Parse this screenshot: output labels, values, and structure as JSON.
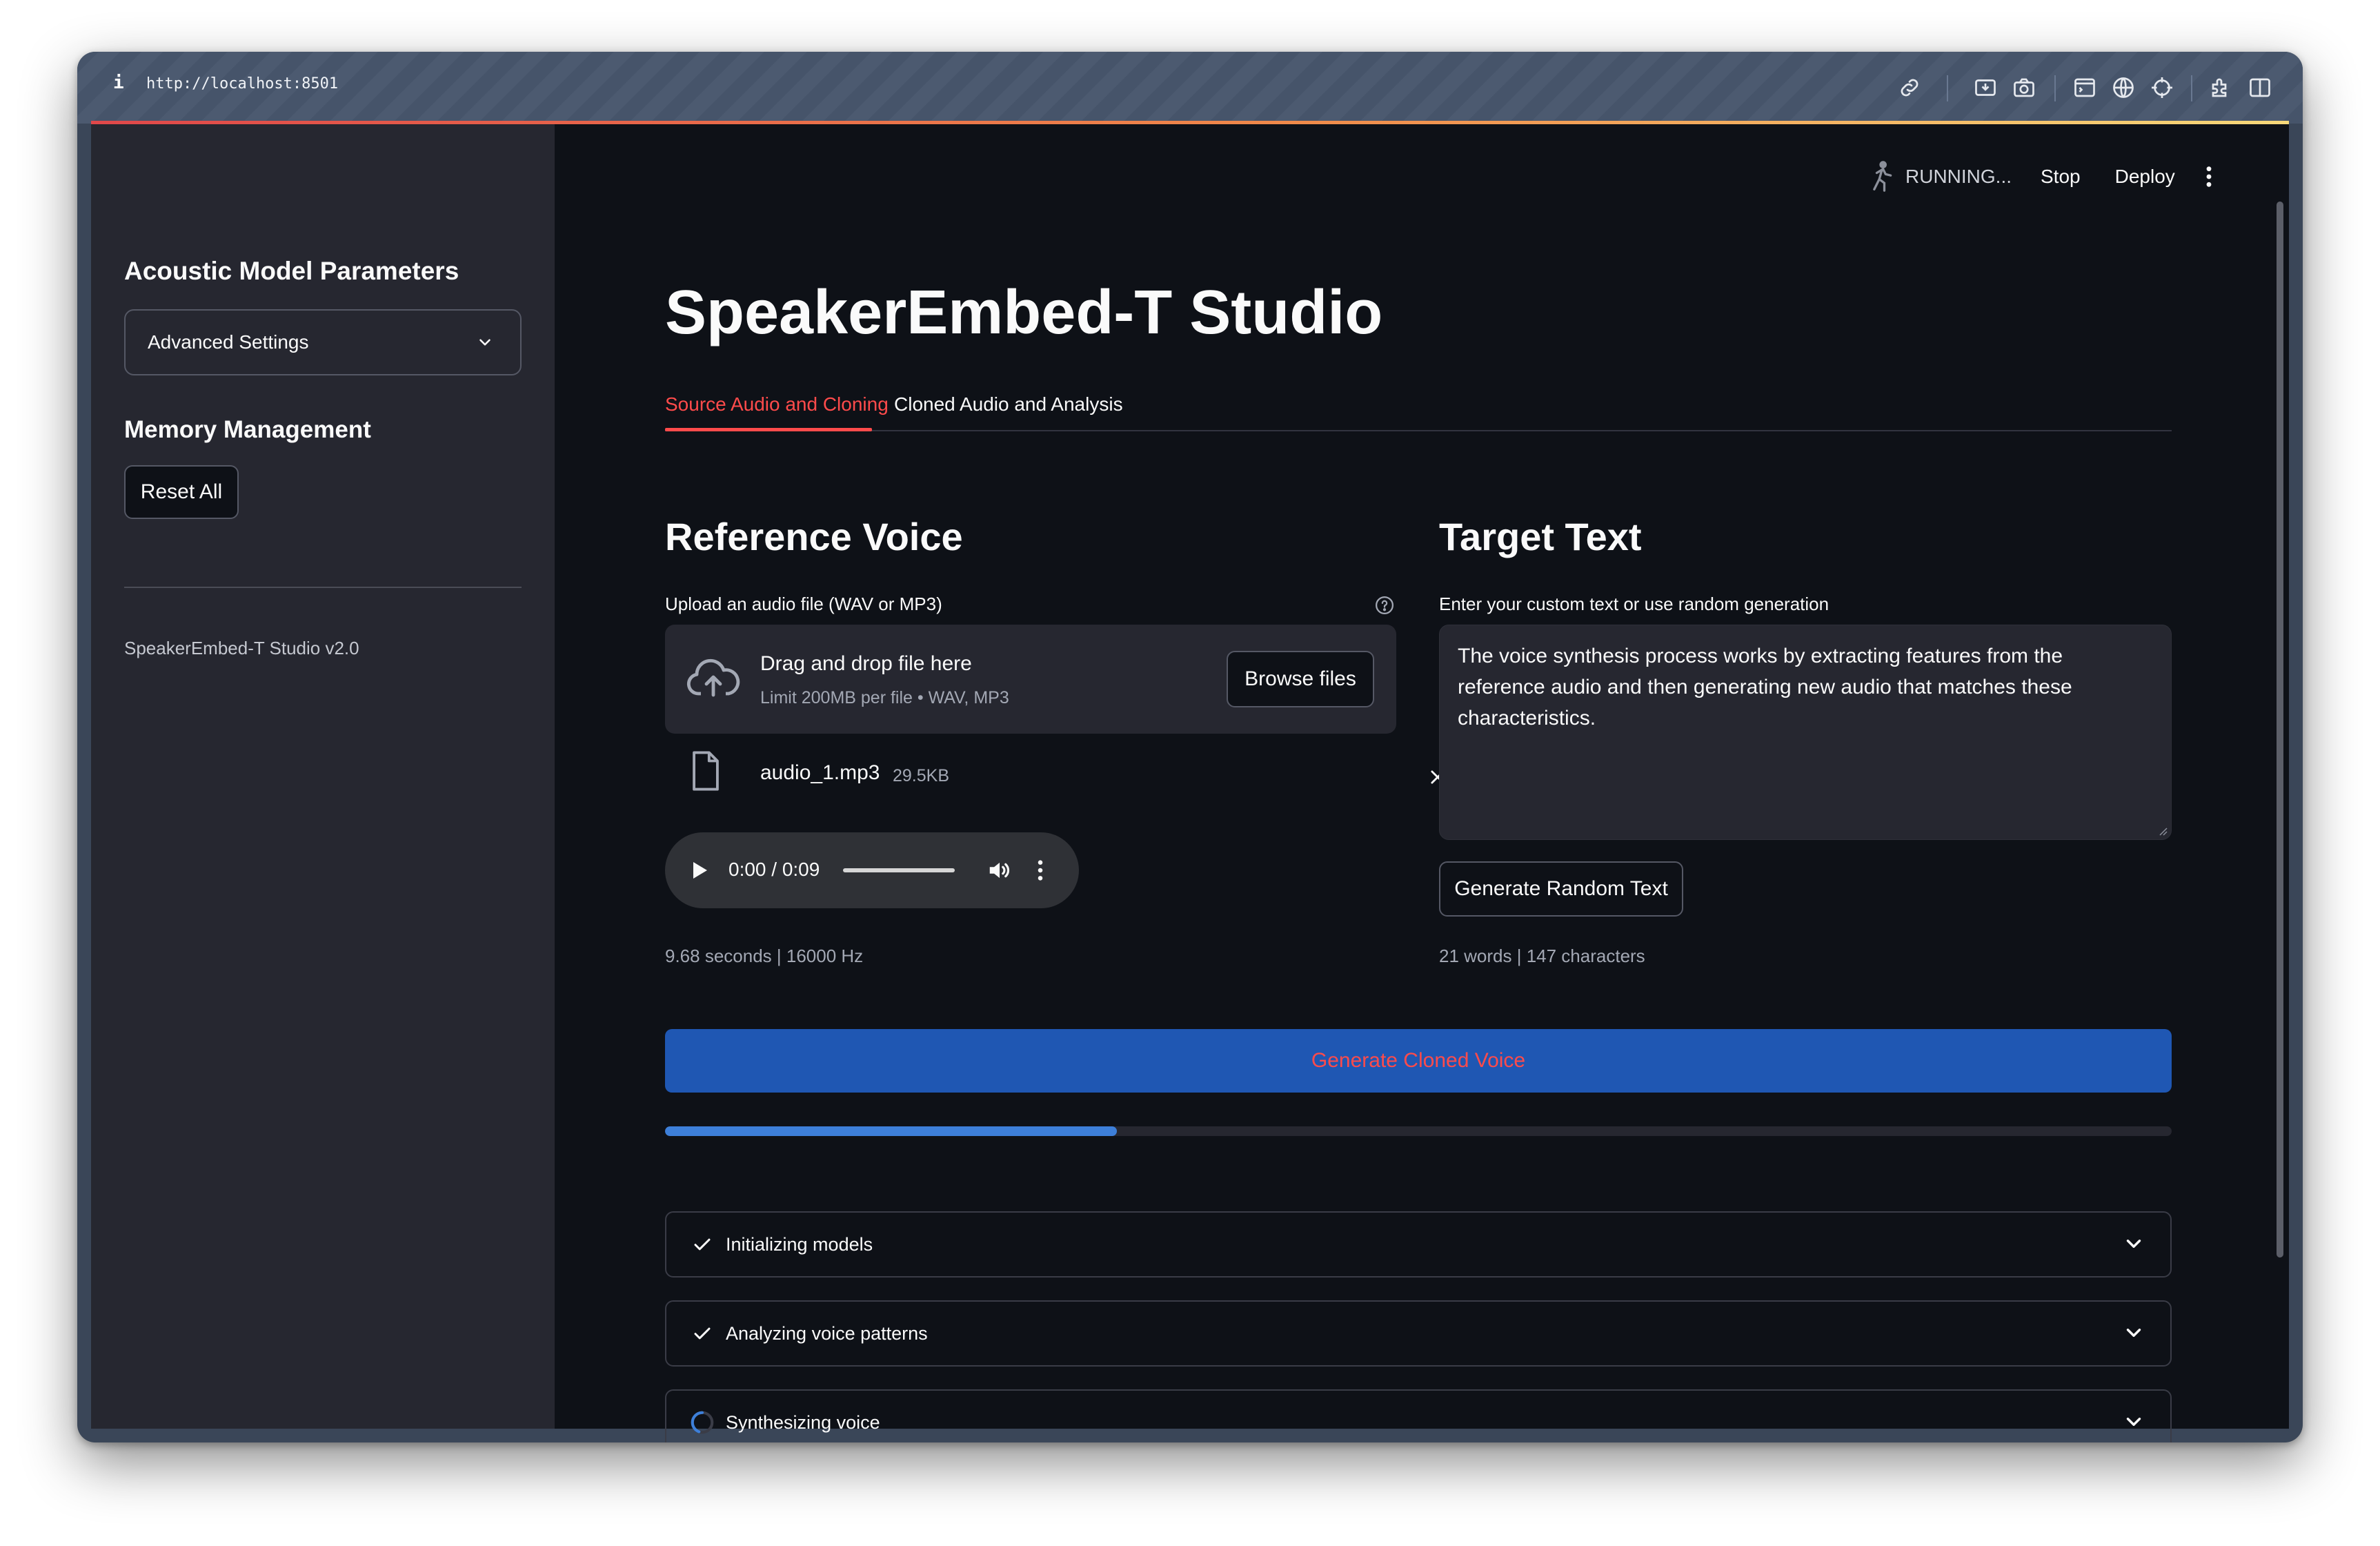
{
  "browser": {
    "info_glyph": "i",
    "url": "http://localhost:8501",
    "icons": [
      "link-icon",
      "download-icon",
      "camera-icon",
      "terminal-icon",
      "globe-icon",
      "crosshair-icon",
      "extension-icon",
      "split-view-icon"
    ]
  },
  "sidebar": {
    "heading_params": "Acoustic Model Parameters",
    "advanced_select": "Advanced Settings",
    "heading_memory": "Memory Management",
    "reset_button": "Reset All",
    "version": "SpeakerEmbed-T Studio v2.0"
  },
  "toolbar": {
    "status": "RUNNING...",
    "stop": "Stop",
    "deploy": "Deploy"
  },
  "page": {
    "title": "SpeakerEmbed-T Studio",
    "tabs": [
      "Source Audio and Cloning",
      "Cloned Audio and Analysis"
    ],
    "active_tab": 0
  },
  "reference": {
    "heading": "Reference Voice",
    "upload_label": "Upload an audio file (WAV or MP3)",
    "drop_main": "Drag and drop file here",
    "drop_sub": "Limit 200MB per file • WAV, MP3",
    "browse": "Browse files",
    "file_name": "audio_1.mp3",
    "file_size": "29.5KB",
    "player_time": "0:00 / 0:09",
    "player_progress": 0.0,
    "meta": "9.68 seconds | 16000 Hz"
  },
  "target": {
    "heading": "Target Text",
    "label": "Enter your custom text or use random generation",
    "text": "The voice synthesis process works by extracting features from the reference audio and then generating new audio that matches these characteristics.",
    "random_button": "Generate Random Text",
    "meta": "21 words | 147 characters"
  },
  "generate": {
    "button": "Generate Cloned Voice",
    "progress_fraction": 0.3
  },
  "steps": [
    {
      "label": "Initializing models",
      "status": "done"
    },
    {
      "label": "Analyzing voice patterns",
      "status": "done"
    },
    {
      "label": "Synthesizing voice",
      "status": "running"
    }
  ],
  "colors": {
    "accent": "#ff4b4b",
    "primary_button": "#1f57b3",
    "progress": "#3d7fd9",
    "background": "#0e1117",
    "sidebar": "#262730"
  }
}
